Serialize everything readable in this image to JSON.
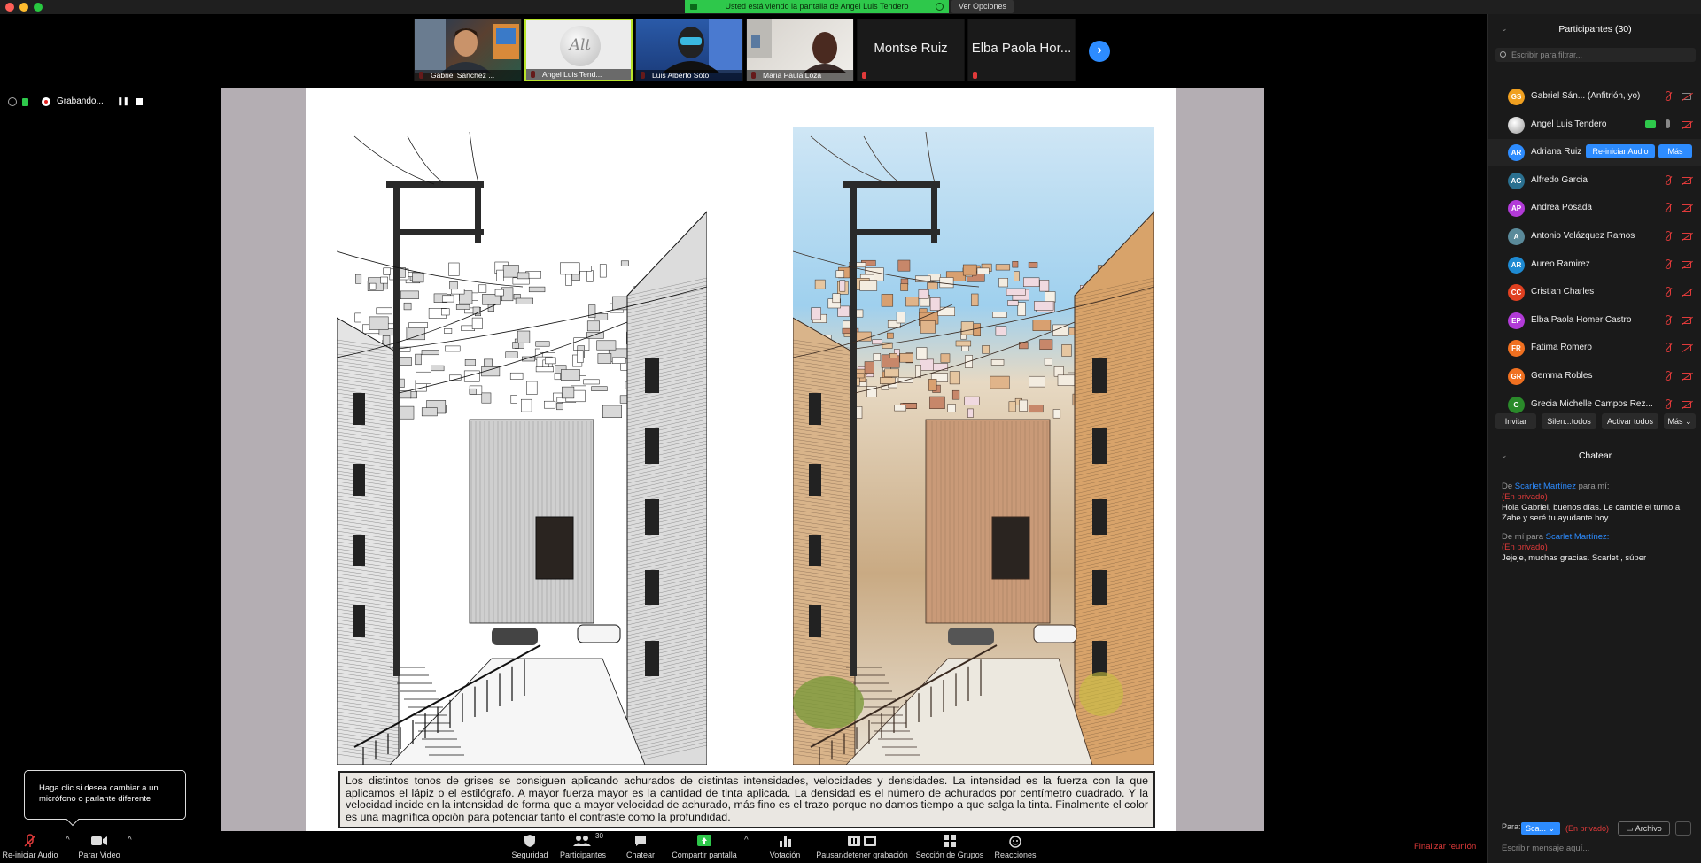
{
  "top_bar": {
    "share_banner": "Usted está viendo la pantalla de Angel Luis Tendero",
    "view_options": "Ver Opciones"
  },
  "gallery": {
    "tiles": [
      {
        "name": "Gabriel Sánchez ..."
      },
      {
        "name": "Angel Luis Tend...",
        "avatar_text": "Alt"
      },
      {
        "name": "Luis Alberto Soto"
      },
      {
        "name": "Maria Paula Loza"
      },
      {
        "big_name": "Montse Ruiz"
      },
      {
        "big_name": "Elba Paola Hor..."
      }
    ],
    "next": "›"
  },
  "recording": {
    "label": "Grabando...",
    "pause": "❚❚"
  },
  "shared_screen": {
    "caption": "Los distintos tonos de grises se consiguen aplicando achurados de distintas intensidades, velocidades y densidades. La intensidad es la fuerza con la que aplicamos el lápiz o el estilógrafo. A mayor fuerza mayor es la cantidad de tinta aplicada. La densidad es el número de achurados por centímetro cuadrado. Y la velocidad incide en la intensidad de forma que a mayor velocidad de achurado, más fino es el trazo porque no damos tiempo a que salga la tinta. Finalmente el color es una magnífica opción para potenciar tanto el contraste como la profundidad."
  },
  "participants": {
    "title": "Participantes (30)",
    "filter_placeholder": "Escribir para filtrar...",
    "list": [
      {
        "initials": "GS",
        "name": "Gabriel Sán...  (Anfitrión, yo)",
        "color": "#f0a020"
      },
      {
        "initials": "",
        "name": "Angel Luis Tendero",
        "color": "#bbbbbb"
      },
      {
        "initials": "AR",
        "name": "Adriana Ruiz",
        "color": "#2d8cff"
      },
      {
        "initials": "AG",
        "name": "Alfredo Garcia",
        "color": "#2a7090"
      },
      {
        "initials": "AP",
        "name": "Andrea Posada",
        "color": "#b23ad8"
      },
      {
        "initials": "A",
        "name": "Antonio Velázquez Ramos",
        "color": "#5a8a9a"
      },
      {
        "initials": "AR",
        "name": "Aureo Ramirez",
        "color": "#1e8ad2"
      },
      {
        "initials": "CC",
        "name": "Cristian Charles",
        "color": "#e04020"
      },
      {
        "initials": "EP",
        "name": "Elba Paola Homer Castro",
        "color": "#b23ad8"
      },
      {
        "initials": "FR",
        "name": "Fatima Romero",
        "color": "#f07020"
      },
      {
        "initials": "GR",
        "name": "Gemma Robles",
        "color": "#f07020"
      },
      {
        "initials": "G",
        "name": "Grecia Michelle Campos Rez...",
        "color": "#2a8a2a"
      }
    ],
    "reinit_audio": "Re-iniciar Audio",
    "more": "Más",
    "invite": "Invitar",
    "mute_all": "Silen...todos",
    "unmute_all": "Activar todos",
    "more2": "Más"
  },
  "chat": {
    "title": "Chatear",
    "messages": [
      {
        "from_prefix": "De",
        "who": "Scarlet Martínez",
        "from_suffix": "para mí:",
        "private": "(En privado)",
        "text": "Hola Gabriel, buenos días. Le cambié el turno a Zahe y seré tu ayudante hoy."
      },
      {
        "from_prefix": "De mí para",
        "who": "Scarlet Martínez:",
        "from_suffix": "",
        "private": "(En privado)",
        "text": "Jejeje, muchas gracias. Scarlet , súper"
      }
    ],
    "to_label": "Para:",
    "to_value": "Sca...",
    "to_private": "(En privado)",
    "file_button": "Archivo",
    "more_dots": "···",
    "input_placeholder": "Escribir mensaje aquí..."
  },
  "toolbar": {
    "tooltip": "Haga clic si desea cambiar a un micrófono o parlante diferente",
    "reinit_audio": "Re-iniciar Audio",
    "stop_video": "Parar Video",
    "security": "Seguridad",
    "participants": "Participantes",
    "participants_count": "30",
    "chat": "Chatear",
    "share_screen": "Compartir pantalla",
    "poll": "Votación",
    "pause_recording": "Pausar/detener grabación",
    "breakout": "Sección de Grupos",
    "reactions": "Reacciones",
    "end_meeting": "Finalizar reunión"
  }
}
